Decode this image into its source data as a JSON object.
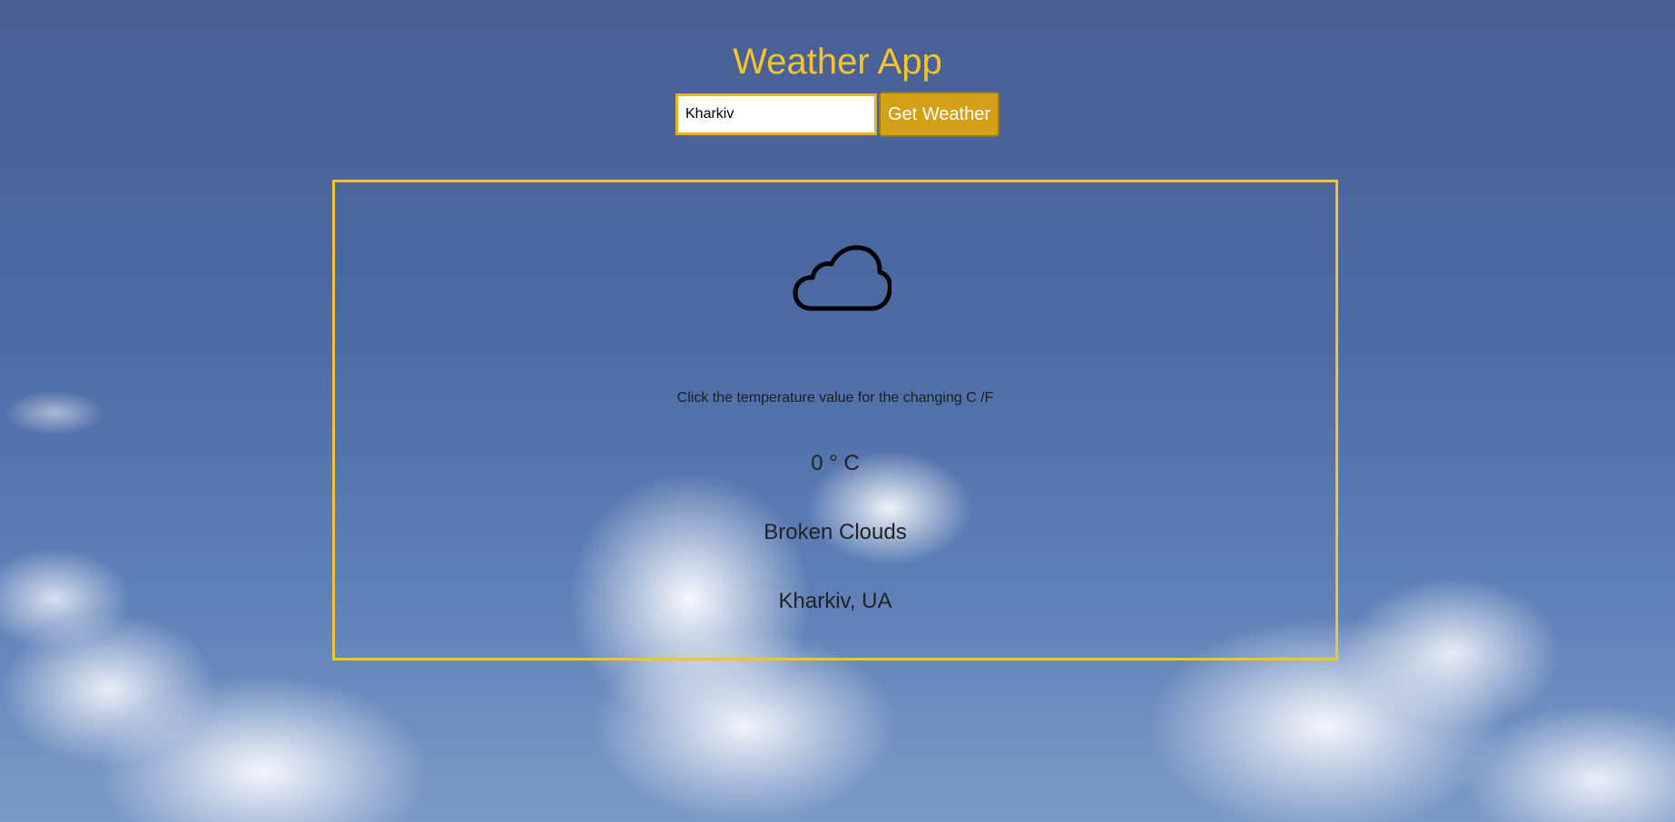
{
  "app": {
    "title": "Weather App"
  },
  "search": {
    "value": "Kharkiv",
    "button_label": "Get Weather"
  },
  "weather": {
    "icon": "cloud-icon",
    "hint": "Click the temperature value for the changing C /F",
    "temperature": "0 ° C",
    "description": "Broken Clouds",
    "location": "Kharkiv, UA"
  },
  "colors": {
    "accent": "#f4c430",
    "button": "#d4a017",
    "text": "#222222"
  }
}
